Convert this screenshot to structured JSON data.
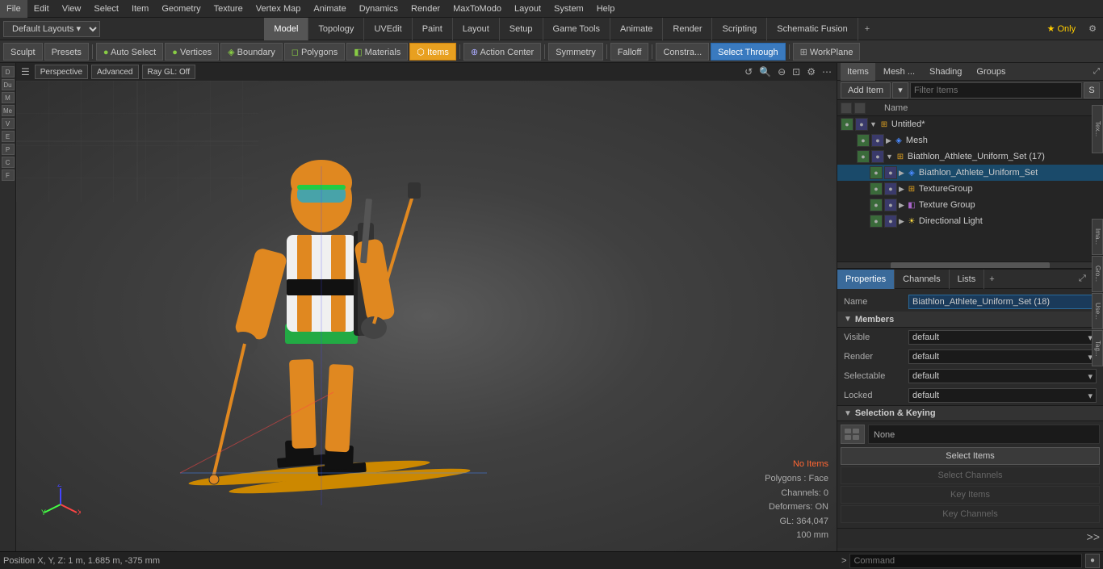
{
  "menubar": {
    "items": [
      "File",
      "Edit",
      "View",
      "Select",
      "Item",
      "Geometry",
      "Texture",
      "Vertex Map",
      "Animate",
      "Dynamics",
      "Render",
      "MaxToModo",
      "Layout",
      "System",
      "Help"
    ]
  },
  "layout_bar": {
    "dropdown": "Default Layouts",
    "tabs": [
      "Model",
      "Topology",
      "UVEdit",
      "Paint",
      "Layout",
      "Setup",
      "Game Tools",
      "Animate",
      "Render",
      "Scripting",
      "Schematic Fusion"
    ],
    "active_tab": "Model",
    "plus_label": "+",
    "star_only": "★ Only"
  },
  "toolbar": {
    "sculpt": "Sculpt",
    "presets": "Presets",
    "auto_select": "Auto Select",
    "vertices": "Vertices",
    "boundary": "Boundary",
    "polygons": "Polygons",
    "materials": "Materials",
    "items": "Items",
    "action_center": "Action Center",
    "symmetry": "Symmetry",
    "falloff": "Falloff",
    "constraints": "Constra...",
    "select_through": "Select Through",
    "workplane": "WorkPlane"
  },
  "viewport": {
    "mode": "Perspective",
    "render_mode": "Advanced",
    "gl_mode": "Ray GL: Off",
    "no_items": "No Items",
    "polygons_face": "Polygons : Face",
    "channels": "Channels: 0",
    "deformers": "Deformers: ON",
    "gl_count": "GL: 364,047",
    "mm": "100 mm"
  },
  "items_panel": {
    "tabs": [
      "Items",
      "Mesh ...",
      "Shading",
      "Groups"
    ],
    "active_tab": "Items",
    "add_item": "Add Item",
    "filter_placeholder": "Filter Items",
    "s_btn": "S",
    "col_name": "Name",
    "tree": [
      {
        "id": "untitled",
        "label": "Untitled*",
        "indent": 0,
        "type": "root",
        "icon": "folder",
        "expanded": true
      },
      {
        "id": "mesh",
        "label": "Mesh",
        "indent": 1,
        "type": "mesh",
        "icon": "mesh",
        "expanded": false
      },
      {
        "id": "biathlon_group",
        "label": "Biathlon_Athlete_Uniform_Set (17)",
        "indent": 1,
        "type": "group",
        "icon": "folder",
        "expanded": true
      },
      {
        "id": "biathlon_item",
        "label": "Biathlon_Athlete_Uniform_Set",
        "indent": 2,
        "type": "mesh",
        "icon": "mesh",
        "expanded": false
      },
      {
        "id": "texture_group_item",
        "label": "TextureGroup",
        "indent": 2,
        "type": "group",
        "icon": "folder",
        "expanded": false
      },
      {
        "id": "texture_group2",
        "label": "Texture Group",
        "indent": 2,
        "type": "texture",
        "icon": "texture",
        "expanded": false
      },
      {
        "id": "directional_light",
        "label": "Directional Light",
        "indent": 2,
        "type": "light",
        "icon": "light",
        "expanded": false
      }
    ]
  },
  "properties": {
    "tabs": [
      "Properties",
      "Channels",
      "Lists"
    ],
    "active_tab": "Properties",
    "name_label": "Name",
    "name_value": "Biathlon_Athlete_Uniform_Set (18)",
    "members_label": "Members",
    "visible_label": "Visible",
    "visible_value": "default",
    "render_label": "Render",
    "render_value": "default",
    "selectable_label": "Selectable",
    "selectable_value": "default",
    "locked_label": "Locked",
    "locked_value": "default",
    "sel_keying_label": "Selection & Keying",
    "none_label": "None",
    "select_items_btn": "Select Items",
    "select_channels_btn": "Select Channels",
    "key_items_btn": "Key Items",
    "key_channels_btn": "Key Channels"
  },
  "right_edge_tabs": [
    "Ima...",
    "Gro...",
    "Use...",
    "Tag..."
  ],
  "bottom": {
    "position": "Position X, Y, Z:  1 m, 1.685 m, -375 mm",
    "command_placeholder": "Command"
  },
  "colors": {
    "accent_blue": "#3a7abf",
    "accent_orange": "#e8a020",
    "selected_row": "#1a4a6a"
  }
}
